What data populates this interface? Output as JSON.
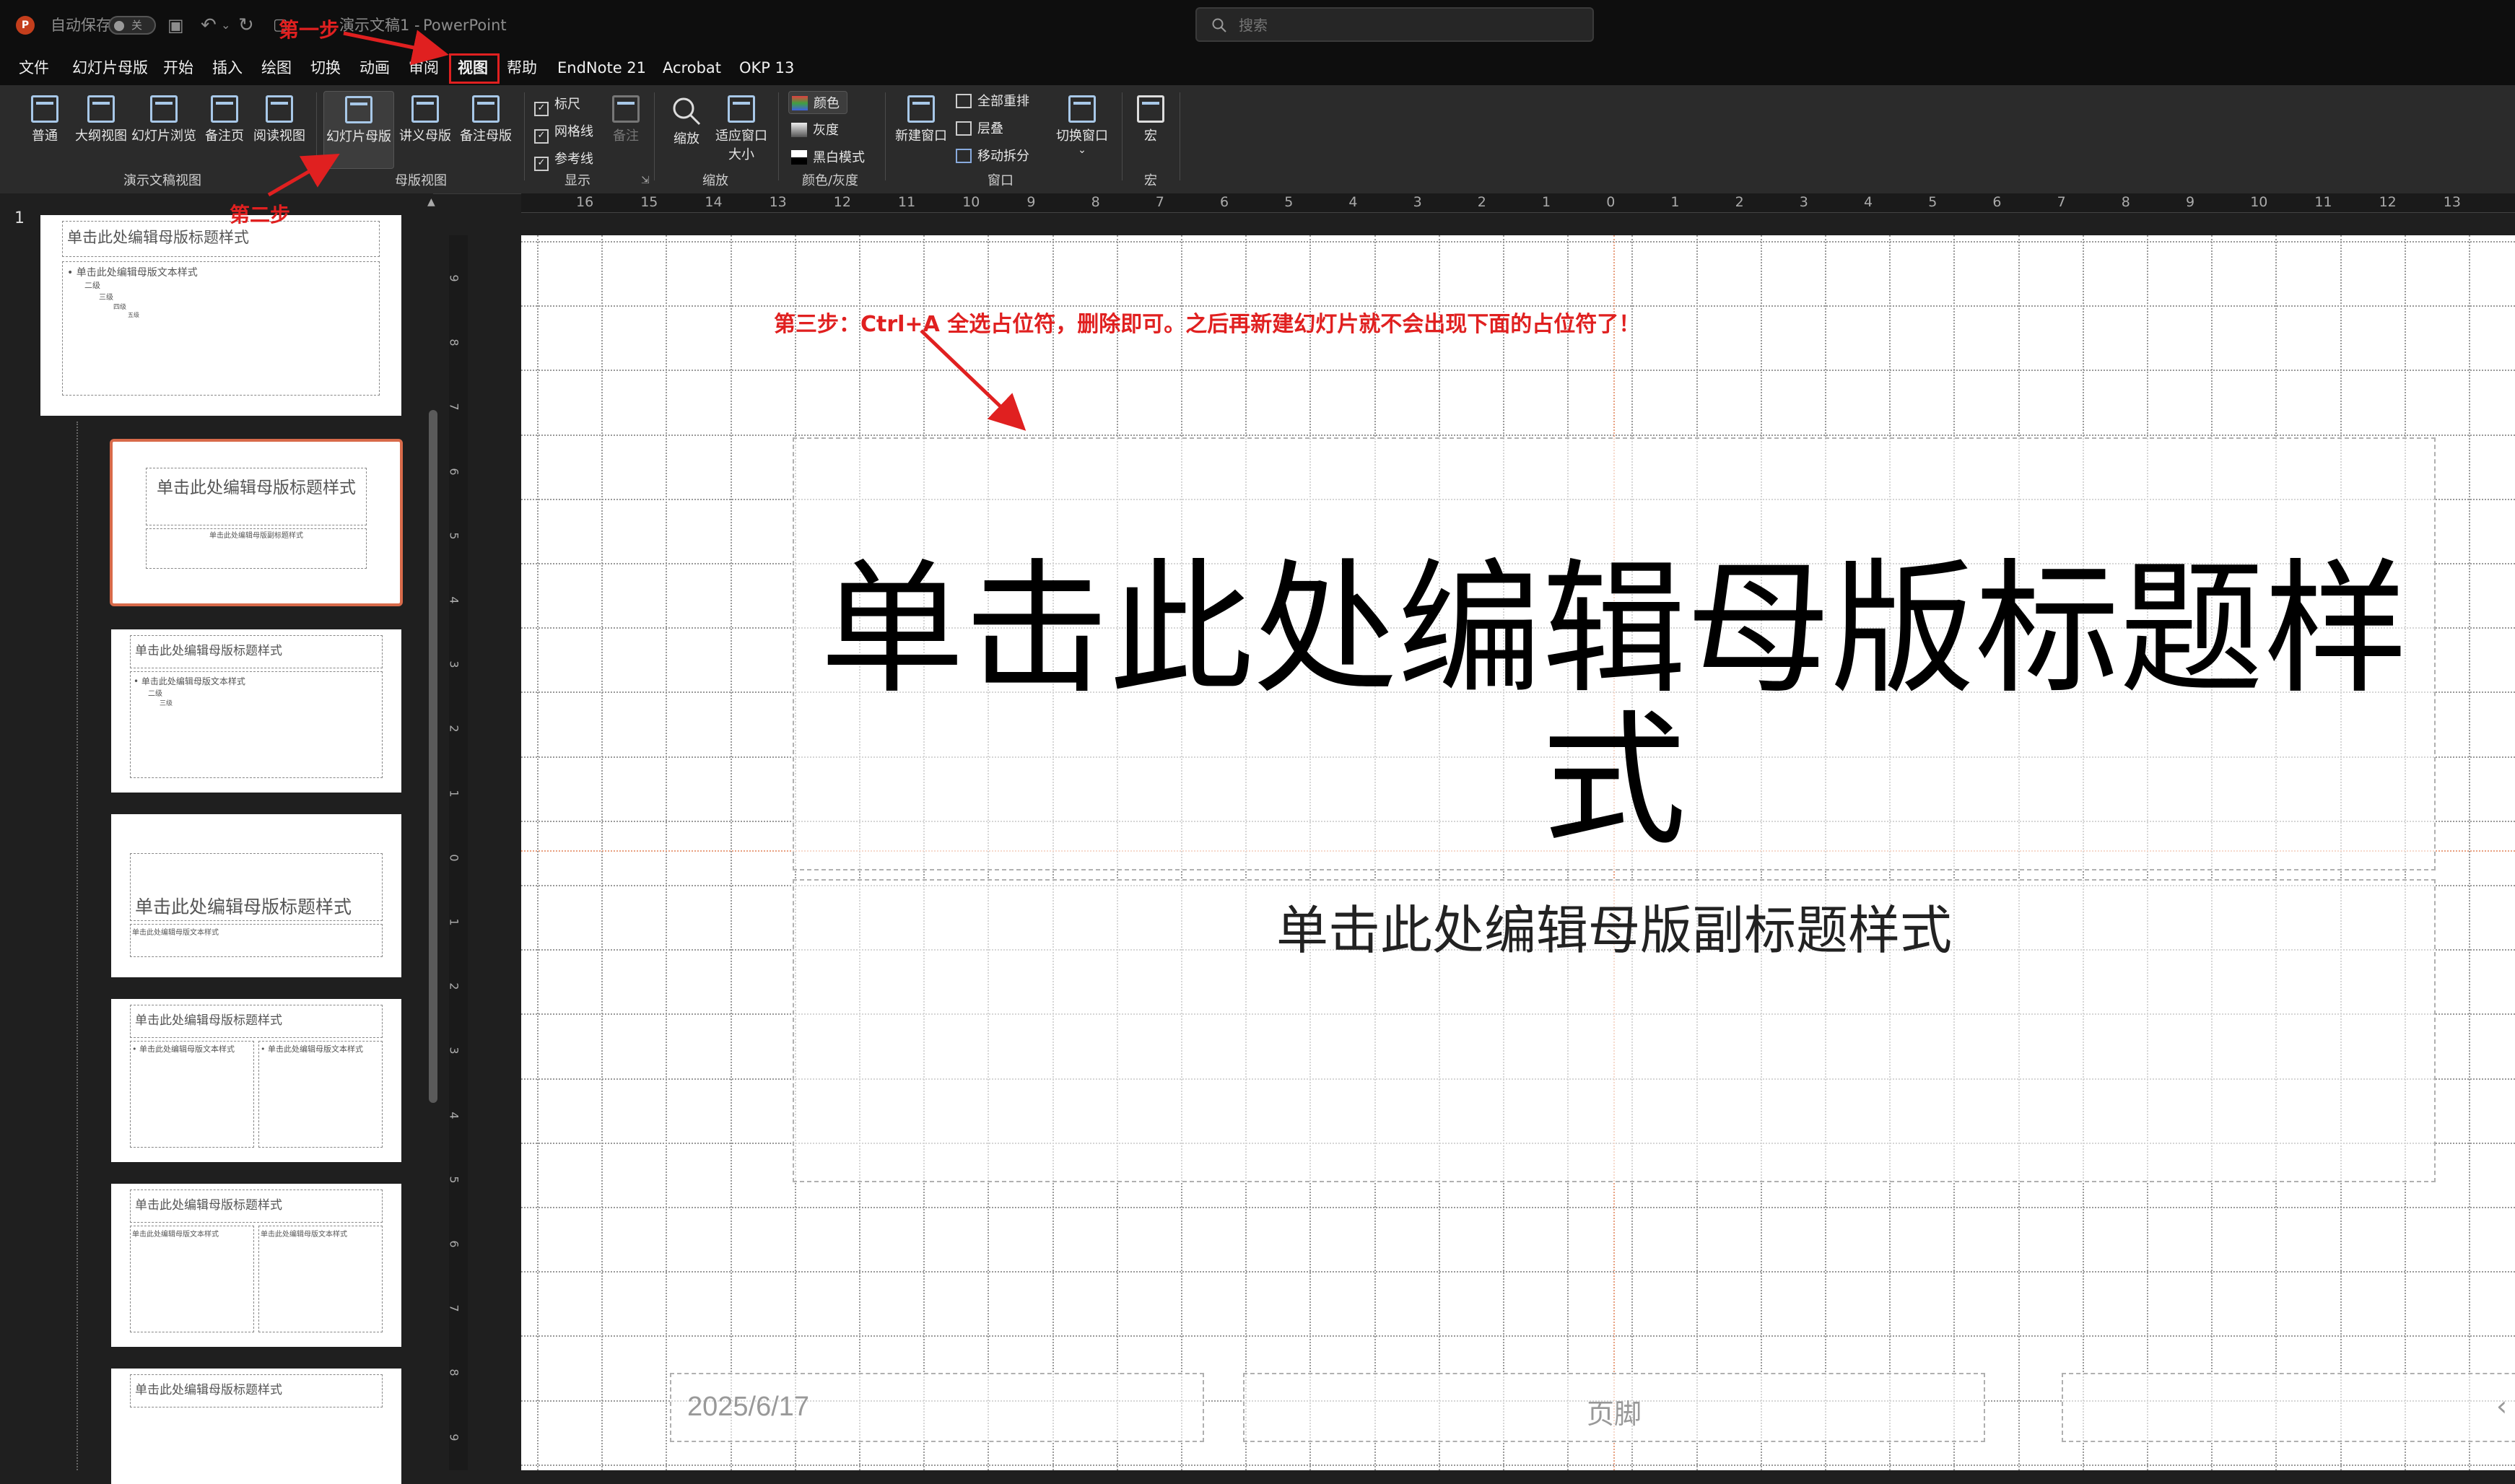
{
  "titlebar": {
    "autosave_label": "自动保存",
    "autosave_state": "关",
    "doc_title": "演示文稿1",
    "app_name": "PowerPoint",
    "search_placeholder": "搜索"
  },
  "menu": [
    "文件",
    "幻灯片母版",
    "开始",
    "插入",
    "绘图",
    "切换",
    "动画",
    "审阅",
    "视图",
    "帮助",
    "EndNote 21",
    "Acrobat",
    "OKP 13"
  ],
  "active_menu": "视图",
  "ribbon": {
    "presentation_views": [
      "普通",
      "大纲视图",
      "幻灯片浏览",
      "备注页",
      "阅读视图"
    ],
    "presentation_views_label": "演示文稿视图",
    "master_views": [
      "幻灯片母版",
      "讲义母版",
      "备注母版"
    ],
    "master_views_label": "母版视图",
    "show": [
      "标尺",
      "网格线",
      "参考线"
    ],
    "notes_label": "备注",
    "show_label": "显示",
    "zoom_btn": "缩放",
    "fit_window_btn": "适应窗口大小",
    "zoom_label": "缩放",
    "color_options": [
      "颜色",
      "灰度",
      "黑白模式"
    ],
    "color_label": "颜色/灰度",
    "new_window": "新建窗口",
    "window_options": [
      "全部重排",
      "层叠",
      "移动拆分"
    ],
    "switch_window": "切换窗口",
    "window_label": "窗口",
    "macro_btn": "宏",
    "macro_label": "宏"
  },
  "rulers": {
    "horizontal": [
      "16",
      "15",
      "14",
      "13",
      "12",
      "11",
      "10",
      "9",
      "8",
      "7",
      "6",
      "5",
      "4",
      "3",
      "2",
      "1",
      "0",
      "1",
      "2",
      "3",
      "4",
      "5",
      "6",
      "7",
      "8",
      "9",
      "10",
      "11",
      "12",
      "13"
    ],
    "vertical": [
      "9",
      "8",
      "7",
      "6",
      "5",
      "4",
      "3",
      "2",
      "1",
      "0",
      "1",
      "2",
      "3",
      "4",
      "5",
      "6",
      "7",
      "8",
      "9"
    ]
  },
  "thumbnails": {
    "slide_number": "1",
    "master_title": "单击此处编辑母版标题样式",
    "master_text": "• 单击此处编辑母版文本样式",
    "level2": "二级",
    "level3": "三级",
    "level4": "四级",
    "level5": "五级",
    "subtitle": "单击此处编辑母版副标题样式",
    "layout_text": "单击此处编辑母版文本样式"
  },
  "slide": {
    "title_line1": "单击此处编辑母版标题样",
    "title_line2": "式",
    "subtitle": "单击此处编辑母版副标题样式",
    "date": "2025/6/17",
    "footer": "页脚",
    "page_marker": "‹"
  },
  "annotations": {
    "step1": "第一步",
    "step2": "第二步",
    "step3": "第三步：Ctrl+A 全选占位符，删除即可。之后再新建幻灯片就不会出现下面的占位符了！"
  }
}
